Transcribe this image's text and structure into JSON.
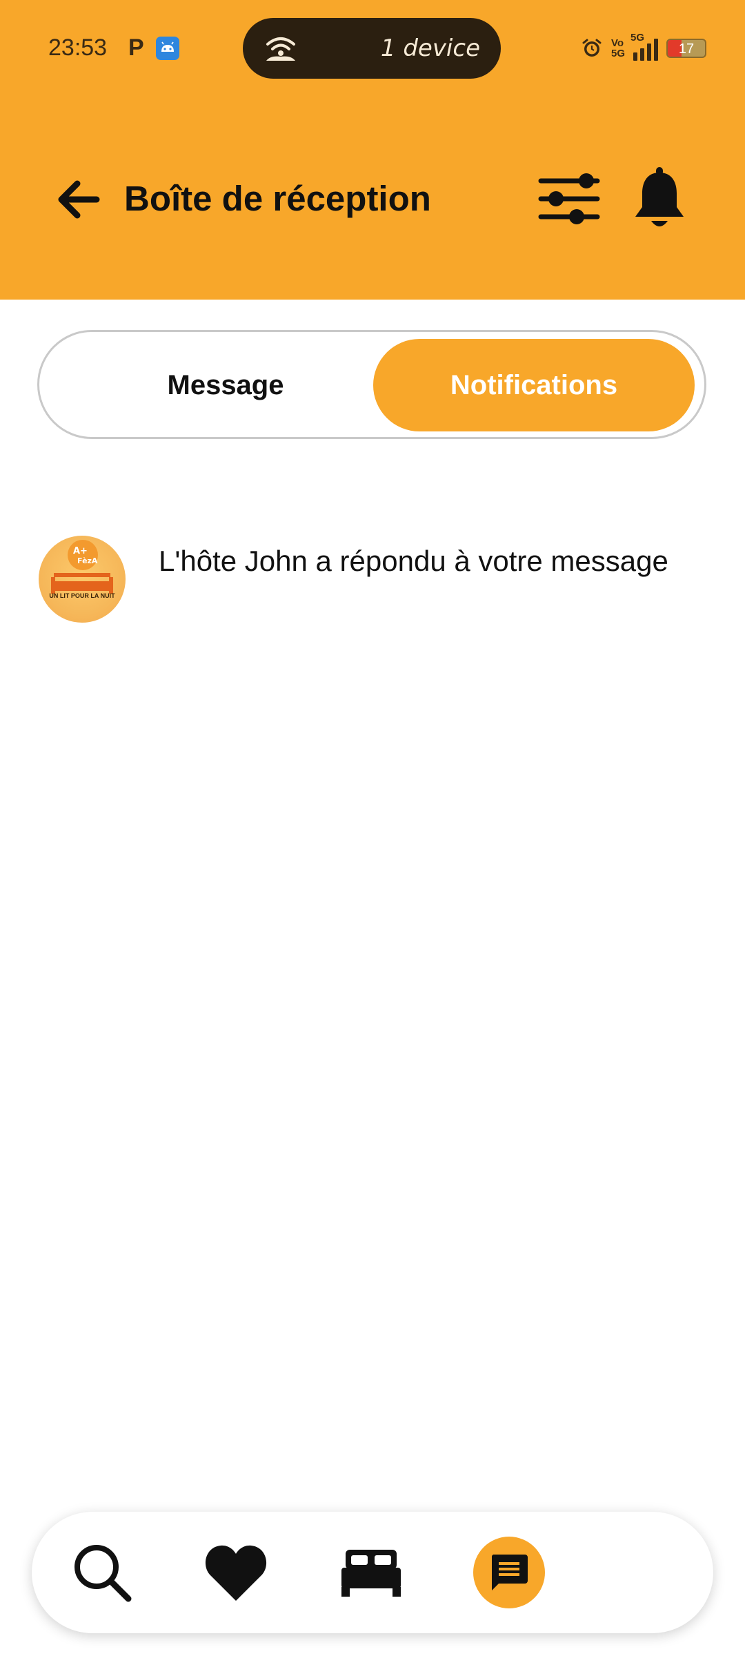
{
  "status_bar": {
    "time": "23:53",
    "notification_letter": "P",
    "hotspot_label": "1 device",
    "network_top": "Vo",
    "network_bottom": "5G",
    "network_type": "5G",
    "battery_level": "17"
  },
  "header": {
    "title": "Boîte de réception",
    "back_icon": "arrow-left-icon",
    "filter_icon": "sliders-icon",
    "bell_icon": "bell-icon",
    "background_color": "#F8A72A"
  },
  "tabs": {
    "items": [
      {
        "label": "Message",
        "selected": false
      },
      {
        "label": "Notifications",
        "selected": true
      }
    ]
  },
  "notifications": [
    {
      "text": "L'hôte John a répondu à votre message",
      "avatar_logo_text": "UN LIT POUR LA NUIT",
      "avatar_logo_brand": "FèzA"
    }
  ],
  "bottom_nav": {
    "items": [
      {
        "icon": "search-icon",
        "active": false
      },
      {
        "icon": "heart-icon",
        "active": false
      },
      {
        "icon": "bed-icon",
        "active": false
      },
      {
        "icon": "message-icon",
        "active": true
      }
    ],
    "active_color": "#F8A72A"
  }
}
